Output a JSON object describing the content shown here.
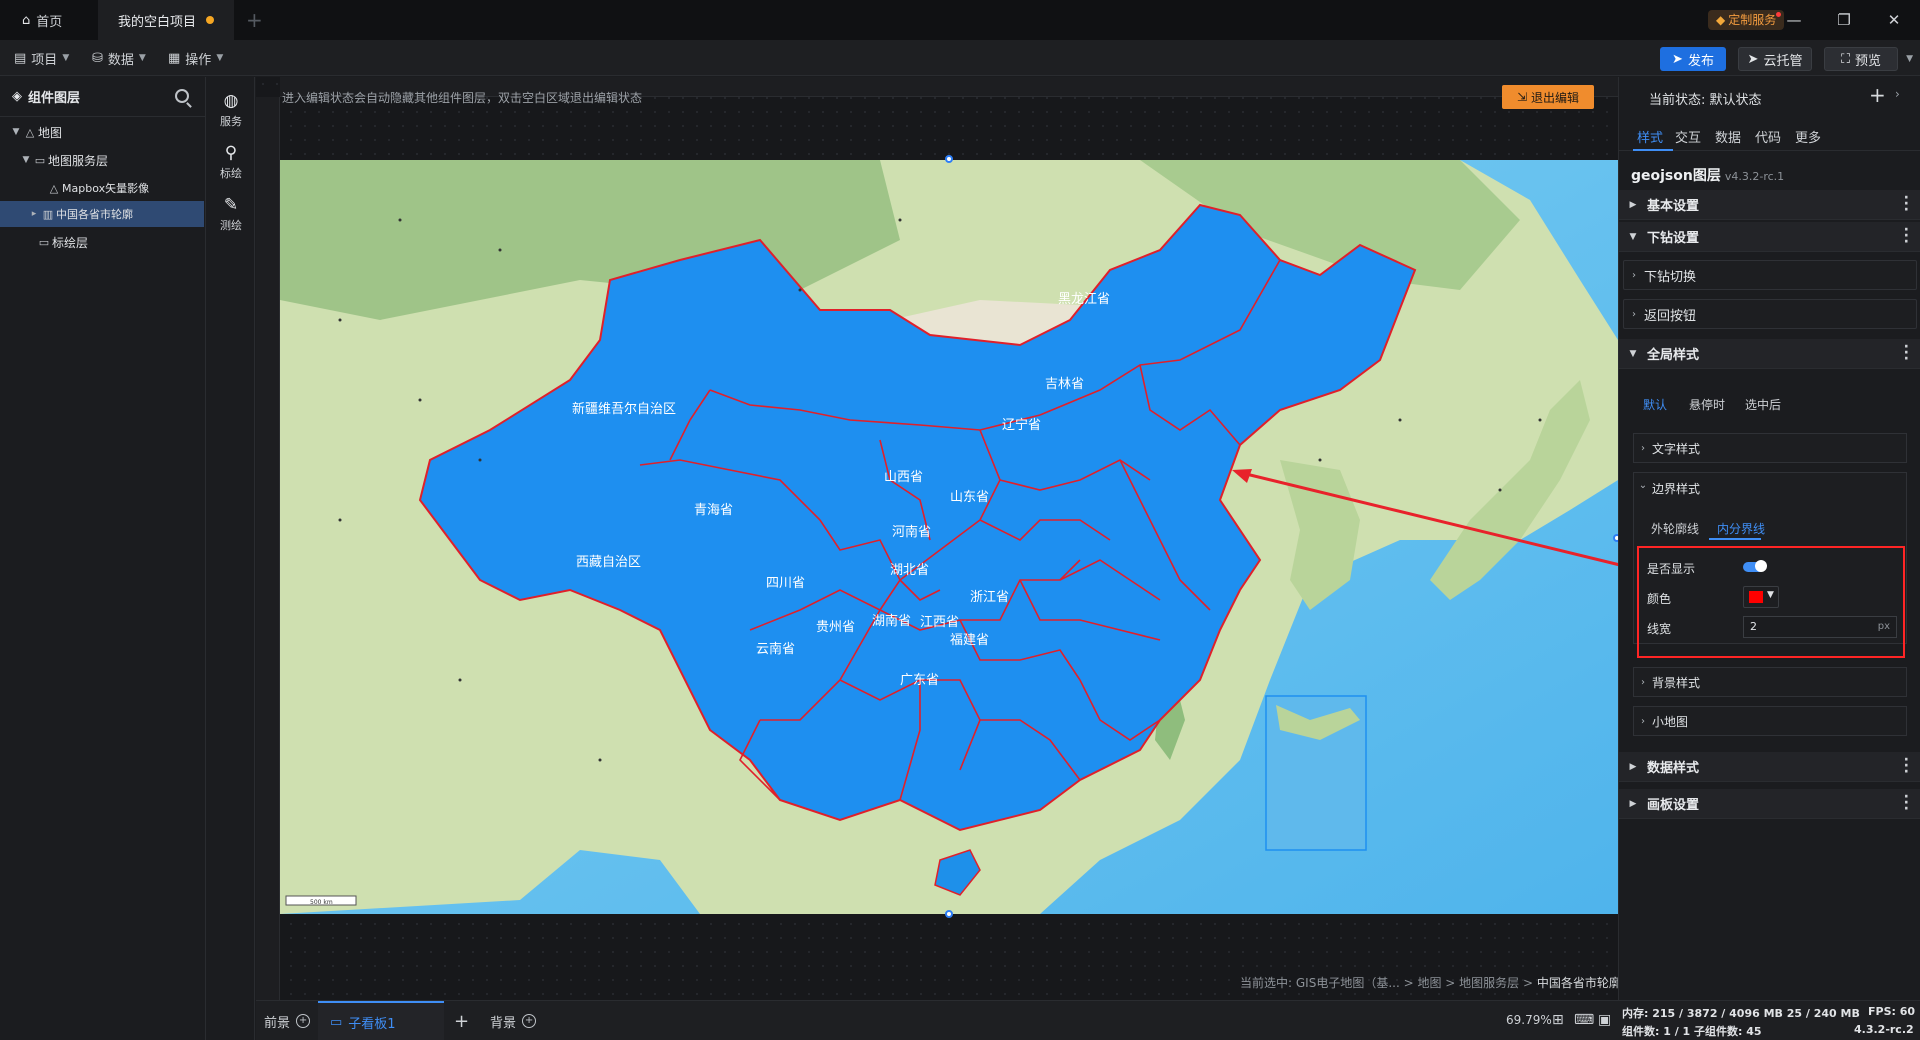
{
  "titlebar": {
    "tabs": [
      {
        "label": "首页",
        "icon": "home-icon"
      },
      {
        "label": "我的空白项目",
        "icon": "unsaved-dot"
      }
    ],
    "custom_service": "定制服务",
    "colors": {
      "accent": "#1e6fe0",
      "unsaved": "#f5a623",
      "custom_service": "#f29b3f"
    }
  },
  "menubar": {
    "menus": [
      {
        "label": "项目",
        "icon": "document-icon"
      },
      {
        "label": "数据",
        "icon": "database-icon"
      },
      {
        "label": "操作",
        "icon": "grid-icon"
      }
    ],
    "actions": {
      "publish": "发布",
      "cloud": "云托管",
      "preview": "预览"
    }
  },
  "layers": {
    "title": "组件图层",
    "items": [
      {
        "label": "地图",
        "icon": "map-icon",
        "level": 0,
        "expanded": true
      },
      {
        "label": "地图服务层",
        "icon": "folder-icon",
        "level": 1,
        "expanded": true
      },
      {
        "label": "Mapbox矢量影像",
        "icon": "map-icon",
        "level": 2
      },
      {
        "label": "中国各省市轮廓",
        "icon": "book-icon",
        "level": 2,
        "selected": true
      },
      {
        "label": "标绘层",
        "icon": "folder-icon",
        "level": 1
      }
    ]
  },
  "tools": [
    {
      "label": "服务",
      "icon": "globe-icon"
    },
    {
      "label": "标绘",
      "icon": "pin-icon"
    },
    {
      "label": "测绘",
      "icon": "measure-icon"
    }
  ],
  "canvas": {
    "hint": "进入编辑状态会自动隐藏其他组件图层，双击空白区域退出编辑状态",
    "exit_edit": "退出编辑",
    "scale": "500 km",
    "provinces": [
      "黑龙江省",
      "吉林省",
      "辽宁省",
      "新疆维吾尔自治区",
      "山西省",
      "山东省",
      "青海省",
      "河南省",
      "西藏自治区",
      "湖北省",
      "四川省",
      "浙江省",
      "贵州省",
      "湖南省",
      "江西省",
      "云南省",
      "福建省",
      "广东省"
    ],
    "status_prefix": "当前选中: GIS电子地图（基...",
    "status_path": [
      "地图",
      "地图服务层"
    ],
    "status_current": "中国各省市轮廓"
  },
  "bottombar": {
    "foreground": "前景",
    "board": "子看板1",
    "background": "背景",
    "zoom": "69.79%"
  },
  "panel": {
    "state_label": "当前状态: 默认状态",
    "tabs": [
      "样式",
      "交互",
      "数据",
      "代码",
      "更多"
    ],
    "layer_name": "geojson图层",
    "version": "v4.3.2-rc.1",
    "sections": {
      "basic": "基本设置",
      "drill": "下钻设置",
      "drill_switch": "下钻切换",
      "back_button": "返回按钮",
      "global": "全局样式",
      "data_style": "数据样式",
      "panel_settings": "画板设置"
    },
    "state_tabs": [
      "默认",
      "悬停时",
      "选中后"
    ],
    "text_style": "文字样式",
    "border_style": "边界样式",
    "border_tabs": [
      "外轮廓线",
      "内分界线"
    ],
    "props": {
      "show_label": "是否显示",
      "show": true,
      "color_label": "颜色",
      "color": "#ff0000",
      "width_label": "线宽",
      "width": "2",
      "width_unit": "px"
    },
    "bg_style": "背景样式",
    "minimap": "小地图"
  },
  "stats": {
    "memory": "内存: 215 / 3872 / 4096 MB  25 / 240 MB",
    "fps": "FPS: 60",
    "components": "组件数: 1 / 1   子组件数: 45",
    "version": "4.3.2-rc.2"
  }
}
